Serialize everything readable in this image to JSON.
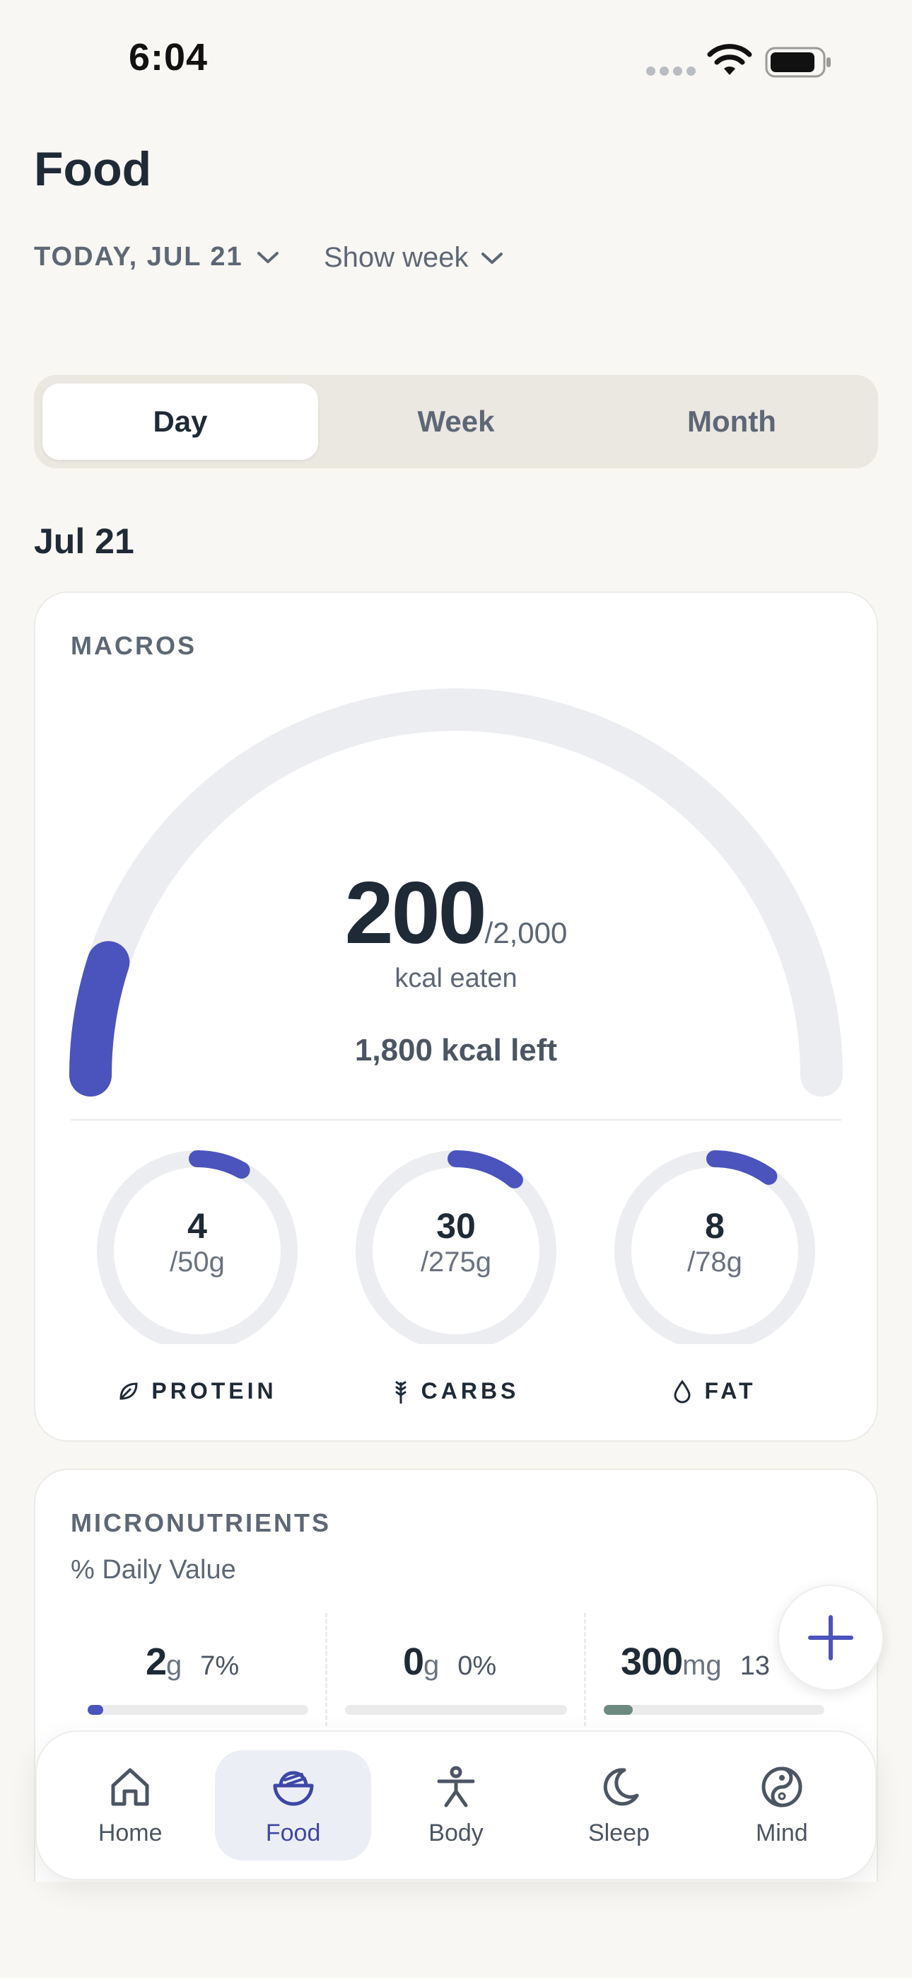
{
  "status": {
    "time": "6:04"
  },
  "header": {
    "title": "Food",
    "date_label": "TODAY, JUL 21",
    "week_toggle": "Show week"
  },
  "segments": {
    "day": "Day",
    "week": "Week",
    "month": "Month",
    "active": "Day"
  },
  "section_date": "Jul 21",
  "macros": {
    "label": "MACROS",
    "eaten": "200",
    "goal": "/2,000",
    "eaten_caption": "kcal eaten",
    "left_text": "1,800 kcal left",
    "progress_fraction": 0.1,
    "rings": [
      {
        "value": "4",
        "goal": "/50g",
        "label": "PROTEIN",
        "icon": "leaf-icon",
        "fraction": 0.08
      },
      {
        "value": "30",
        "goal": "/275g",
        "label": "CARBS",
        "icon": "wheat-icon",
        "fraction": 0.11
      },
      {
        "value": "8",
        "goal": "/78g",
        "label": "FAT",
        "icon": "droplet-icon",
        "fraction": 0.1
      }
    ]
  },
  "micro": {
    "label": "MICRONUTRIENTS",
    "sub": "% Daily Value",
    "items": [
      {
        "value": "2",
        "unit": "g",
        "pct": "7%",
        "fraction": 0.07,
        "color": "#4b53bc"
      },
      {
        "value": "0",
        "unit": "g",
        "pct": "0%",
        "fraction": 0.0,
        "color": "#4b53bc"
      },
      {
        "value": "300",
        "unit": "mg",
        "pct": "13",
        "fraction": 0.13,
        "color": "#6c8a80"
      }
    ]
  },
  "fab": {
    "icon": "plus-icon"
  },
  "tabbar": {
    "items": [
      {
        "label": "Home",
        "icon": "home-icon"
      },
      {
        "label": "Food",
        "icon": "food-bowl-icon"
      },
      {
        "label": "Body",
        "icon": "body-icon"
      },
      {
        "label": "Sleep",
        "icon": "moon-icon"
      },
      {
        "label": "Mind",
        "icon": "yin-yang-icon"
      }
    ],
    "active": "Food"
  },
  "colors": {
    "accent": "#4b53bc",
    "track": "#ecedf0",
    "background": "#f9f7f3"
  }
}
